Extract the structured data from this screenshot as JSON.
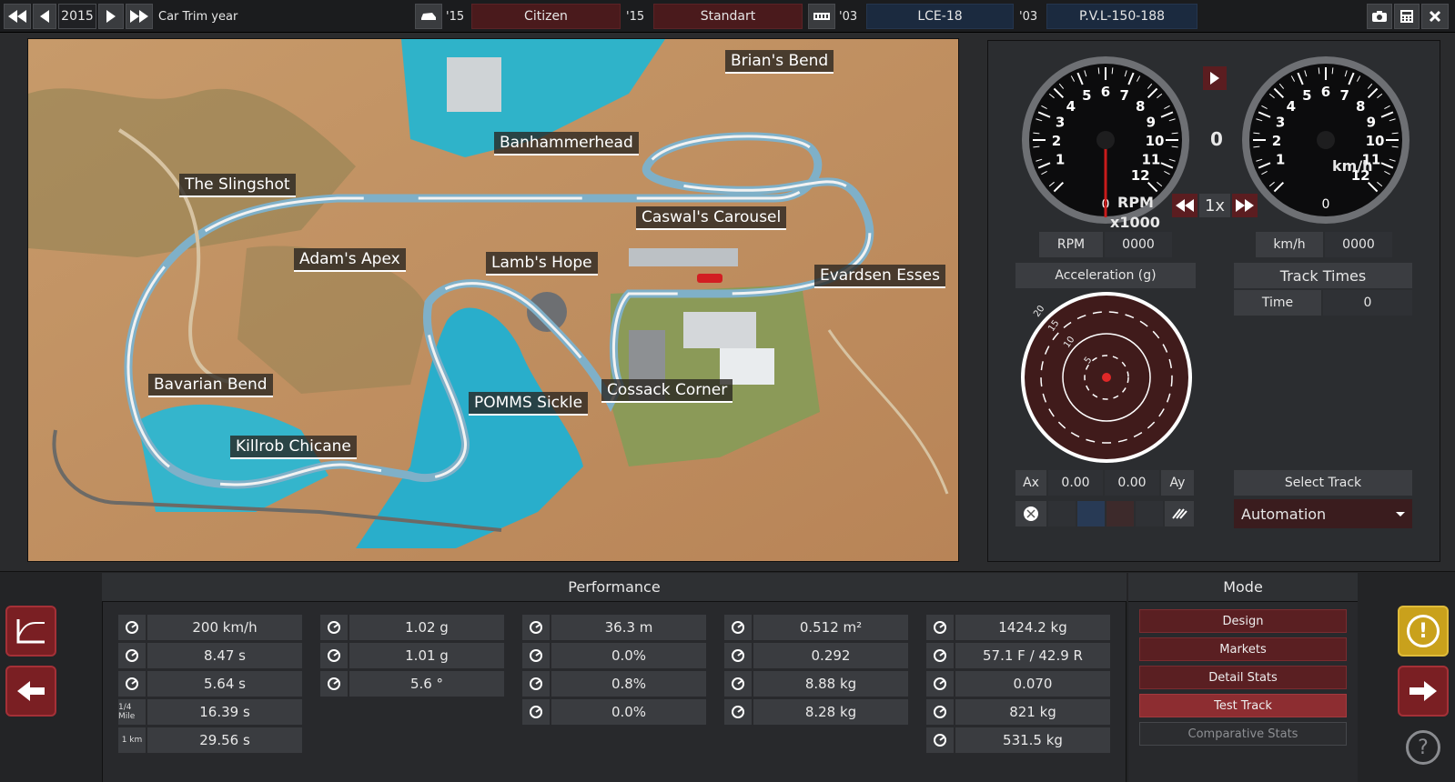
{
  "topbar": {
    "year": "2015",
    "year_label": "Car Trim year",
    "model_year_1": "'15",
    "model_name": "Citizen",
    "trim_year": "'15",
    "trim_name": "Standart",
    "engine_year_1": "'03",
    "engine_family": "LCE-18",
    "engine_year_2": "'03",
    "engine_variant": "P.V.L-150-188"
  },
  "map": {
    "corners": [
      "Brian's Bend",
      "Banhammerhead",
      "The Slingshot",
      "Caswal's Carousel",
      "Adam's Apex",
      "Lamb's Hope",
      "Evardsen Esses",
      "Bavarian Bend",
      "POMMS Sickle",
      "Cossack Corner",
      "Killrob Chicane"
    ]
  },
  "gauges": {
    "rpm_ticks": [
      "1",
      "2",
      "3",
      "4",
      "5",
      "6",
      "7",
      "8",
      "9",
      "10",
      "11",
      "12"
    ],
    "rpm_unit_1": "RPM",
    "rpm_unit_2": "x1000",
    "rpm_zero": "0",
    "speed_ticks": [
      "1",
      "2",
      "3",
      "4",
      "5",
      "6",
      "7",
      "8",
      "9",
      "10",
      "11",
      "12"
    ],
    "speed_unit": "km/h",
    "speed_zero": "0",
    "gear": "0",
    "speed_multiplier": "1x",
    "rpm_label": "RPM",
    "rpm_value": "0000",
    "kmh_label": "km/h",
    "kmh_value": "0000"
  },
  "accel": {
    "title": "Acceleration (g)",
    "rings": [
      "20",
      "15",
      "10",
      "5"
    ],
    "ax_label": "Ax",
    "ax_value": "0.00",
    "ay_value": "0.00",
    "ay_label": "Ay"
  },
  "tracktimes": {
    "title": "Track Times",
    "time_label": "Time",
    "time_value": "0",
    "select_track": "Select Track",
    "track_name": "Automation"
  },
  "performance": {
    "title": "Performance",
    "col1": [
      {
        "icon": "speedometer-icon",
        "glyph": "",
        "value": "200 km/h"
      },
      {
        "icon": "accel-100-icon",
        "glyph": "",
        "value": "8.47 s"
      },
      {
        "icon": "accel-60-icon",
        "glyph": "",
        "value": "5.64 s"
      },
      {
        "icon": "quarter-mile-icon",
        "glyph": "1/4 Mile",
        "value": "16.39 s"
      },
      {
        "icon": "km-icon",
        "glyph": "1 km",
        "value": "29.56 s"
      }
    ],
    "col2": [
      {
        "icon": "lateral-g-icon",
        "value": "1.02 g"
      },
      {
        "icon": "lateral-g2-icon",
        "value": "1.01 g"
      },
      {
        "icon": "body-roll-icon",
        "value": "5.6 °"
      }
    ],
    "col3": [
      {
        "icon": "braking-distance-icon",
        "value": "36.3 m"
      },
      {
        "icon": "brake-fade-icon",
        "value": "0.0%"
      },
      {
        "icon": "understeer-icon",
        "value": "0.8%"
      },
      {
        "icon": "oversteer-icon",
        "value": "0.0%"
      }
    ],
    "col4": [
      {
        "icon": "frontal-area-icon",
        "value": "0.512 m²"
      },
      {
        "icon": "drag-icon",
        "value": "0.292"
      },
      {
        "icon": "downforce-front-icon",
        "value": "8.88 kg"
      },
      {
        "icon": "downforce-rear-icon",
        "value": "8.28 kg"
      }
    ],
    "col5": [
      {
        "icon": "weight-icon",
        "value": "1424.2 kg"
      },
      {
        "icon": "weight-distribution-icon",
        "value": "57.1 F / 42.9 R"
      },
      {
        "icon": "drag-coefficient-icon",
        "value": "0.070"
      },
      {
        "icon": "front-axle-icon",
        "value": "821 kg"
      },
      {
        "icon": "rear-axle-icon",
        "value": "531.5 kg"
      }
    ]
  },
  "mode": {
    "title": "Mode",
    "buttons": [
      "Design",
      "Markets",
      "Detail Stats",
      "Test Track",
      "Comparative Stats"
    ]
  },
  "help_glyph": "?",
  "warning_glyph": "!"
}
